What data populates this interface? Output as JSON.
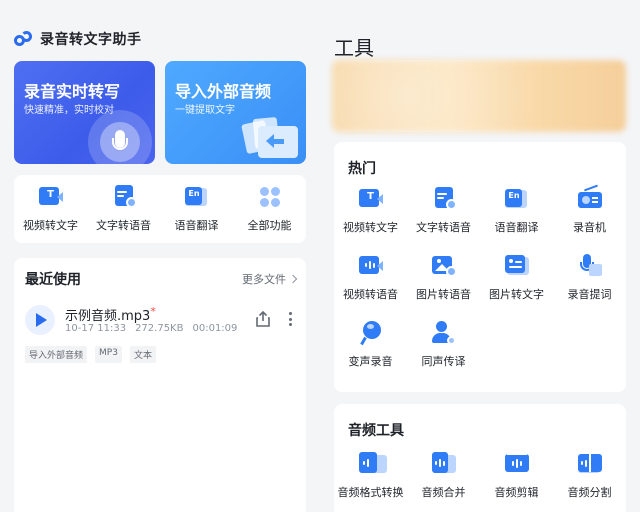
{
  "app": {
    "title": "录音转文字助手"
  },
  "hero": {
    "record": {
      "title": "录音实时转写",
      "subtitle": "快速精准，实时校对"
    },
    "import": {
      "title": "导入外部音频",
      "subtitle": "一键提取文字"
    }
  },
  "quick_actions": [
    {
      "label": "视频转文字",
      "icon": "video-to-text-icon"
    },
    {
      "label": "文字转语音",
      "icon": "text-to-speech-icon"
    },
    {
      "label": "语音翻译",
      "icon": "voice-translate-icon"
    },
    {
      "label": "全部功能",
      "icon": "all-features-icon"
    }
  ],
  "recent": {
    "title": "最近使用",
    "more_label": "更多文件",
    "file": {
      "name": "示例音频.mp3",
      "date": "10-17 11:33",
      "size": "272.75KB",
      "duration": "00:01:09",
      "tags": [
        "导入外部音频",
        "MP3",
        "文本"
      ]
    }
  },
  "tools": {
    "title": "工具",
    "hot": {
      "title": "热门",
      "items": [
        {
          "label": "视频转文字",
          "icon": "video-to-text-icon"
        },
        {
          "label": "文字转语音",
          "icon": "text-to-speech-icon"
        },
        {
          "label": "语音翻译",
          "icon": "voice-translate-icon"
        },
        {
          "label": "录音机",
          "icon": "recorder-icon"
        },
        {
          "label": "视频转语音",
          "icon": "video-to-audio-icon"
        },
        {
          "label": "图片转语音",
          "icon": "image-to-speech-icon"
        },
        {
          "label": "图片转文字",
          "icon": "image-to-text-icon"
        },
        {
          "label": "录音提词",
          "icon": "teleprompter-icon"
        },
        {
          "label": "变声录音",
          "icon": "voice-changer-icon"
        },
        {
          "label": "同声传译",
          "icon": "simultaneous-interpretation-icon"
        }
      ]
    },
    "audio": {
      "title": "音频工具",
      "items": [
        {
          "label": "音频格式转换",
          "icon": "audio-format-convert-icon"
        },
        {
          "label": "音频合并",
          "icon": "audio-merge-icon"
        },
        {
          "label": "音频剪辑",
          "icon": "audio-cut-icon"
        },
        {
          "label": "音频分割",
          "icon": "audio-split-icon"
        }
      ]
    }
  },
  "colors": {
    "accent": "#2f7cf6",
    "hero_record": "#4a64ee",
    "hero_import": "#3a8ff6",
    "unsaved_dot": "#f54a45"
  }
}
